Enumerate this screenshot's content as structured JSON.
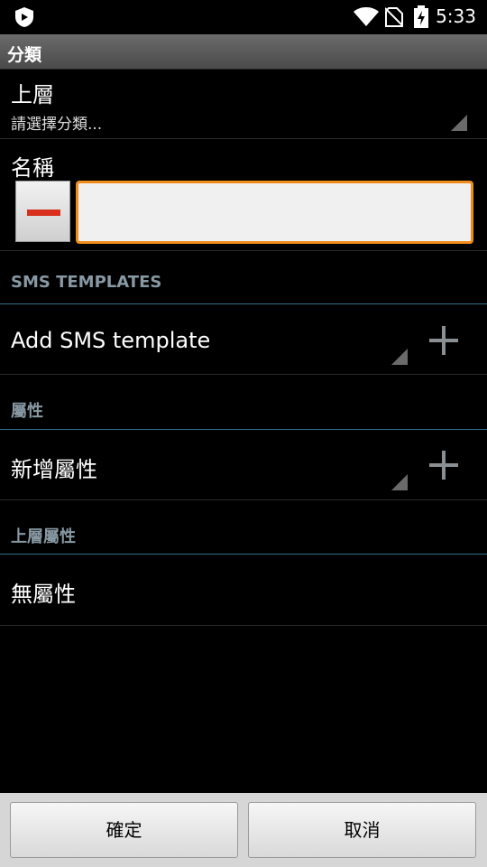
{
  "status_bar": {
    "time": "5:33",
    "icons": [
      "app-shield-icon",
      "wifi-icon",
      "no-sim-icon",
      "battery-charging-icon"
    ]
  },
  "title_bar": {
    "title": "分類"
  },
  "parent_field": {
    "label": "上層",
    "selected_value": "請選擇分類..."
  },
  "name_field": {
    "label": "名稱",
    "value": ""
  },
  "sms_templates_section": {
    "header": "SMS TEMPLATES",
    "add_label": "Add SMS template",
    "add_icon": "plus-icon"
  },
  "attributes_section": {
    "header": "屬性",
    "add_label": "新增屬性",
    "add_icon": "plus-icon"
  },
  "parent_attributes_section": {
    "header": "上層屬性",
    "empty_text": "無屬性"
  },
  "buttons": {
    "confirm": "確定",
    "cancel": "取消"
  },
  "colors": {
    "accent_orange": "#f08c1a",
    "minus_red": "#d8301c",
    "section_header": "#8899a3",
    "divider_blue": "#2e6d8c"
  }
}
